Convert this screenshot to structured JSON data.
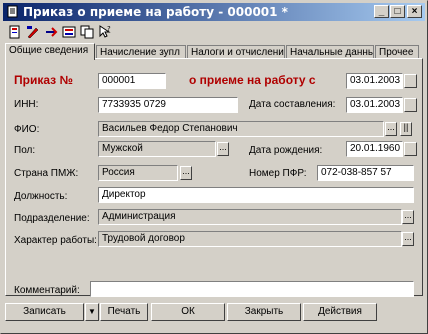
{
  "window": {
    "title": "Приказ о приеме на работу - 000001 *"
  },
  "titlebar_buttons": {
    "minimize": "_",
    "maximize": "□",
    "close": "×"
  },
  "toolbar": {
    "icons": [
      "new-doc-icon",
      "edit-icon",
      "arrow-right-icon",
      "list-icon",
      "copy-icon",
      "help-pointer-icon"
    ]
  },
  "tabs": [
    {
      "label": "Общие сведения"
    },
    {
      "label": "Начисление зупл"
    },
    {
      "label": "Налоги и отчисления"
    },
    {
      "label": "Начальные данные"
    },
    {
      "label": "Прочее"
    }
  ],
  "form": {
    "order_no_label": "Приказ №",
    "order_no": "000001",
    "order_title": "о приеме на работу с",
    "start_date": "03.01.2003",
    "inn_label": "ИНН:",
    "inn": "7733935 0729",
    "doc_date_label": "Дата составления:",
    "doc_date": "03.01.2003",
    "fio_label": "ФИО:",
    "fio": "Васильев Федор Степанович",
    "sex_label": "Пол:",
    "sex": "Мужской",
    "birth_label": "Дата рождения:",
    "birth": "20.01.1960",
    "country_label": "Страна ПМЖ:",
    "country": "Россия",
    "pfr_label": "Номер ПФР:",
    "pfr": "072-038-857 57",
    "position_label": "Должность:",
    "position": "Директор",
    "dept_label": "Подразделение:",
    "dept": "Администрация",
    "work_label": "Характер работы:",
    "work": "Трудовой договор",
    "comment_label": "Комментарий:",
    "comment": ""
  },
  "buttons": {
    "save": "Записать",
    "save_dropdown": "▼",
    "print": "Печать",
    "ok": "ОК",
    "close": "Закрыть",
    "actions": "Действия"
  }
}
